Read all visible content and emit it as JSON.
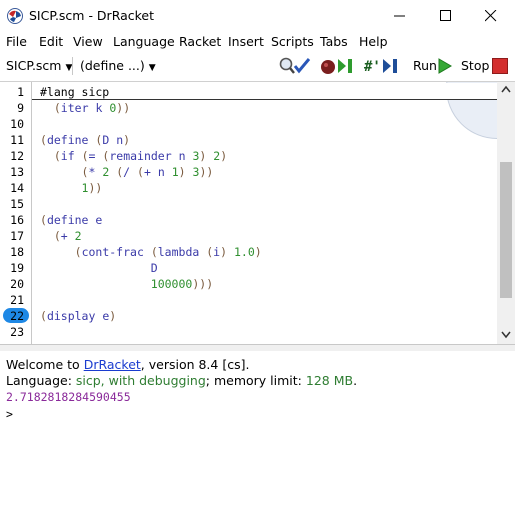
{
  "window": {
    "title": "SICP.scm - DrRacket",
    "controls": [
      "minimize",
      "maximize",
      "close"
    ]
  },
  "menu": [
    "File",
    "Edit",
    "View",
    "Language",
    "Racket",
    "Insert",
    "Scripts",
    "Tabs",
    "Help"
  ],
  "toolbar": {
    "file_dropdown": "SICP.scm",
    "define_dropdown": "(define ...)",
    "run_label": "Run",
    "stop_label": "Stop"
  },
  "editor": {
    "first_line": {
      "number": "1",
      "text": "#lang sicp"
    },
    "lines": [
      {
        "number": "9",
        "text": "  (iter k 0))"
      },
      {
        "number": "10",
        "text": ""
      },
      {
        "number": "11",
        "text": "(define (D n)"
      },
      {
        "number": "12",
        "text": "  (if (= (remainder n 3) 2)"
      },
      {
        "number": "13",
        "text": "      (* 2 (/ (+ n 1) 3))"
      },
      {
        "number": "14",
        "text": "      1))"
      },
      {
        "number": "15",
        "text": ""
      },
      {
        "number": "16",
        "text": "(define e"
      },
      {
        "number": "17",
        "text": "  (+ 2"
      },
      {
        "number": "18",
        "text": "     (cont-frac (lambda (i) 1.0)"
      },
      {
        "number": "19",
        "text": "                D"
      },
      {
        "number": "20",
        "text": "                100000)))"
      },
      {
        "number": "21",
        "text": ""
      },
      {
        "number": "22",
        "text": "(display e)"
      },
      {
        "number": "23",
        "text": ""
      }
    ],
    "current_line": "22"
  },
  "repl": {
    "welcome_prefix": "Welcome to ",
    "welcome_link": "DrRacket",
    "welcome_suffix": ", version 8.4 [cs].",
    "language_prefix": "Language: ",
    "language_value": "sicp, with debugging",
    "memory_prefix": "; memory limit: ",
    "memory_value": "128 MB",
    "memory_suffix": ".",
    "output": "2.7182818284590455",
    "prompt": ">"
  },
  "colors": {
    "paren": "#7a5a3e",
    "symbol": "#3a3aa8",
    "number": "#2f8f2f",
    "current_line_highlight": "#1e88e5",
    "repl_output": "#8a2a9a",
    "link": "#1a3ccf"
  }
}
